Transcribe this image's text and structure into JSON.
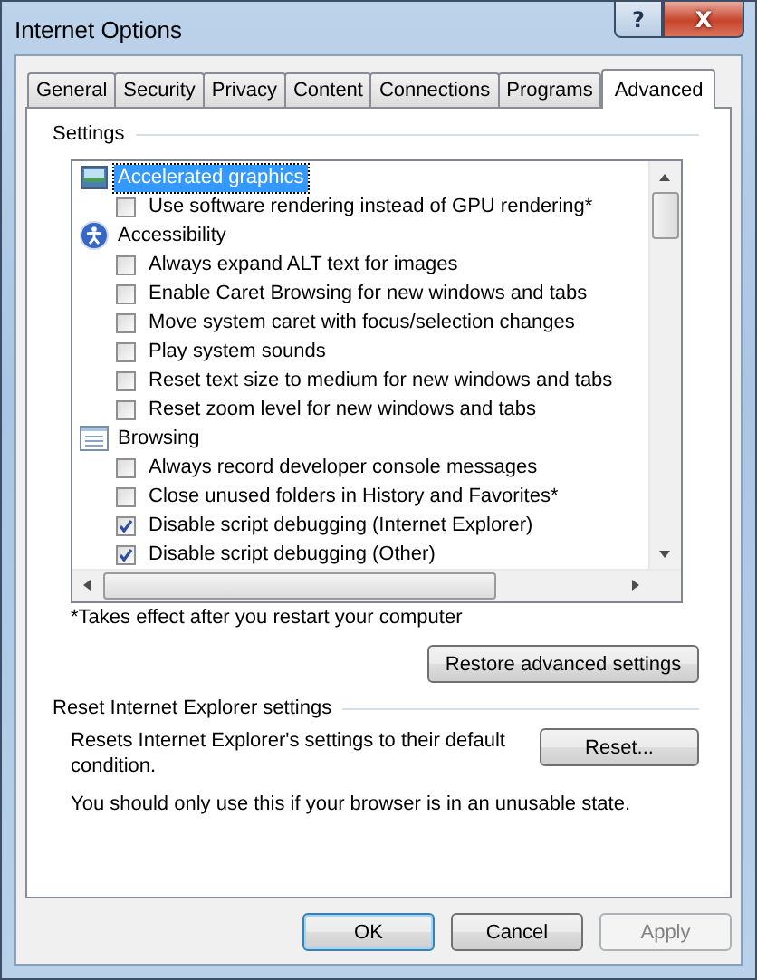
{
  "window": {
    "title": "Internet Options"
  },
  "caption_buttons": [
    {
      "kind": "help",
      "label": "?"
    },
    {
      "kind": "close",
      "label": "X"
    }
  ],
  "tabs": [
    {
      "label": "General",
      "selected": false
    },
    {
      "label": "Security",
      "selected": false
    },
    {
      "label": "Privacy",
      "selected": false
    },
    {
      "label": "Content",
      "selected": false
    },
    {
      "label": "Connections",
      "selected": false
    },
    {
      "label": "Programs",
      "selected": false
    },
    {
      "label": "Advanced",
      "selected": true
    }
  ],
  "settings": {
    "heading": "Settings",
    "items": [
      {
        "kind": "category",
        "label": "Accelerated graphics",
        "selected": true
      },
      {
        "kind": "checkbox",
        "label": "Use software rendering instead of GPU rendering*",
        "checked": false
      },
      {
        "kind": "category",
        "label": "Accessibility",
        "selected": false
      },
      {
        "kind": "checkbox",
        "label": "Always expand ALT text for images",
        "checked": false
      },
      {
        "kind": "checkbox",
        "label": "Enable Caret Browsing for new windows and tabs",
        "checked": false
      },
      {
        "kind": "checkbox",
        "label": "Move system caret with focus/selection changes",
        "checked": false
      },
      {
        "kind": "checkbox",
        "label": "Play system sounds",
        "checked": false
      },
      {
        "kind": "checkbox",
        "label": "Reset text size to medium for new windows and tabs",
        "checked": false
      },
      {
        "kind": "checkbox",
        "label": "Reset zoom level for new windows and tabs",
        "checked": false
      },
      {
        "kind": "category",
        "label": "Browsing",
        "selected": false
      },
      {
        "kind": "checkbox",
        "label": "Always record developer console messages",
        "checked": false
      },
      {
        "kind": "checkbox",
        "label": "Close unused folders in History and Favorites*",
        "checked": false
      },
      {
        "kind": "checkbox",
        "label": "Disable script debugging (Internet Explorer)",
        "checked": true
      },
      {
        "kind": "checkbox",
        "label": "Disable script debugging (Other)",
        "checked": true
      }
    ],
    "note": "*Takes effect after you restart your computer",
    "restore_button": "Restore advanced settings"
  },
  "reset": {
    "heading": "Reset Internet Explorer settings",
    "description": "Resets Internet Explorer's settings to their default condition.",
    "button": "Reset...",
    "warning": "You should only use this if your browser is in an unusable state."
  },
  "buttons": [
    {
      "label": "OK",
      "default": true,
      "disabled": false
    },
    {
      "label": "Cancel",
      "default": false,
      "disabled": false
    },
    {
      "label": "Apply",
      "default": false,
      "disabled": true
    }
  ]
}
